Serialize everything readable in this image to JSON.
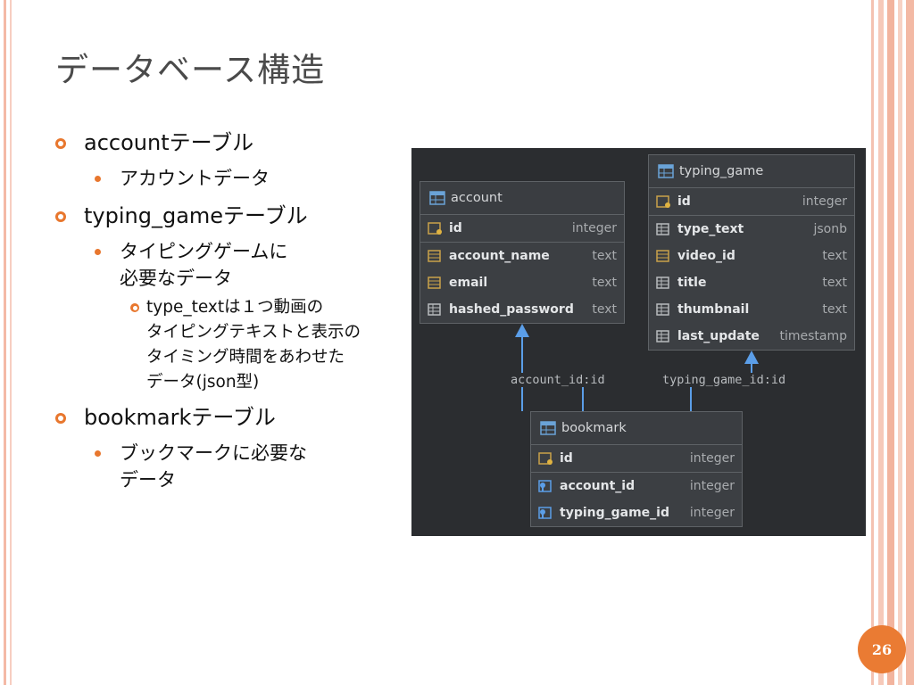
{
  "slide": {
    "title": "データベース構造",
    "page_number": "26",
    "accent_color": "#e8772e"
  },
  "bullets": [
    {
      "text": "accountテーブル",
      "children": [
        {
          "lines": [
            "アカウントデータ"
          ]
        }
      ]
    },
    {
      "text": "typing_gameテーブル",
      "children": [
        {
          "lines": [
            "タイピングゲームに",
            "必要なデータ"
          ],
          "children": [
            {
              "lines": [
                "type_textは１つ動画の",
                "タイピングテキストと表示の",
                "タイミング時間をあわせた",
                "データ(json型)"
              ]
            }
          ]
        }
      ]
    },
    {
      "text": "bookmarkテーブル",
      "children": [
        {
          "lines": [
            "ブックマークに必要な",
            "データ"
          ]
        }
      ]
    }
  ],
  "diagram": {
    "background": "#2b2d30",
    "tables": {
      "account": {
        "name": "account",
        "columns": [
          {
            "name": "id",
            "type": "integer",
            "icon": "primary-key-icon"
          },
          {
            "name": "account_name",
            "type": "text",
            "icon": "column-icon"
          },
          {
            "name": "email",
            "type": "text",
            "icon": "column-icon"
          },
          {
            "name": "hashed_password",
            "type": "text",
            "icon": "column-icon"
          }
        ]
      },
      "typing_game": {
        "name": "typing_game",
        "columns": [
          {
            "name": "id",
            "type": "integer",
            "icon": "primary-key-icon"
          },
          {
            "name": "type_text",
            "type": "jsonb",
            "icon": "column-icon"
          },
          {
            "name": "video_id",
            "type": "text",
            "icon": "column-icon"
          },
          {
            "name": "title",
            "type": "text",
            "icon": "column-icon"
          },
          {
            "name": "thumbnail",
            "type": "text",
            "icon": "column-icon"
          },
          {
            "name": "last_update",
            "type": "timestamp",
            "icon": "column-icon"
          }
        ]
      },
      "bookmark": {
        "name": "bookmark",
        "columns": [
          {
            "name": "id",
            "type": "integer",
            "icon": "primary-key-icon"
          },
          {
            "name": "account_id",
            "type": "integer",
            "icon": "foreign-key-icon"
          },
          {
            "name": "typing_game_id",
            "type": "integer",
            "icon": "foreign-key-icon"
          }
        ]
      }
    },
    "relations": {
      "account": "account_id:id",
      "typing_game": "typing_game_id:id"
    }
  }
}
